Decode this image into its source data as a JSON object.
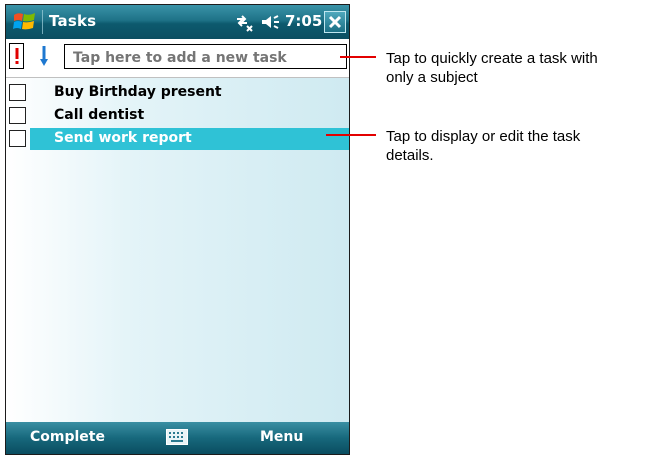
{
  "window": {
    "title": "Tasks",
    "time": "7:05"
  },
  "entry": {
    "placeholder": "Tap here to add a new task"
  },
  "tasks": [
    {
      "label": "Buy Birthday present",
      "checked": false,
      "selected": false
    },
    {
      "label": "Call dentist",
      "checked": false,
      "selected": false
    },
    {
      "label": "Send work report",
      "checked": false,
      "selected": true
    }
  ],
  "softkeys": {
    "left": "Complete",
    "right": "Menu"
  },
  "callouts": [
    {
      "text_line1": "Tap to quickly create a task with",
      "text_line2": "only a subject"
    },
    {
      "text_line1": "Tap to display or edit the task",
      "text_line2": "details."
    }
  ],
  "icons": {
    "start": "windows-start-icon",
    "connectivity": "connectivity-icon",
    "volume": "volume-icon",
    "close": "close-icon",
    "priority": "priority-exclamation-icon",
    "sort": "sort-down-arrow-icon",
    "keyboard": "keyboard-icon"
  },
  "colors": {
    "selection": "#2fc2d6",
    "callout_line": "#e30000",
    "titlebar": "#1e7287"
  }
}
